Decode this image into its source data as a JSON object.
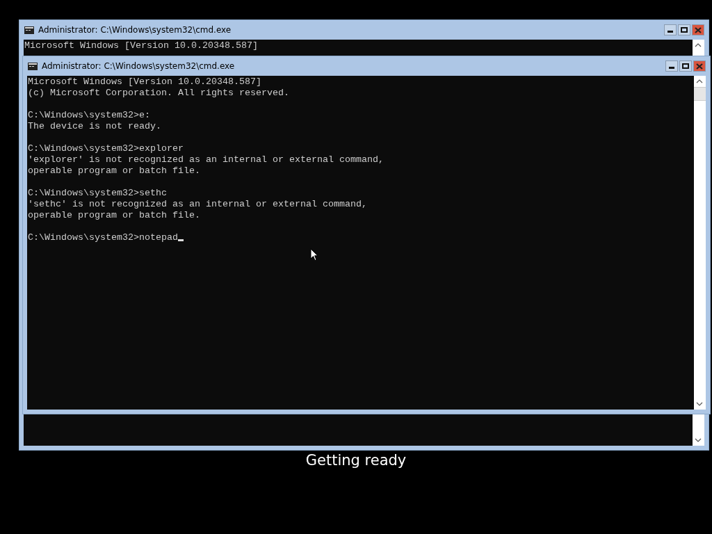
{
  "windows": [
    {
      "title": "Administrator: C:\\Windows\\system32\\cmd.exe",
      "blocks": [
        [
          "Microsoft Windows [Version 10.0.20348.587]"
        ]
      ],
      "cursor": false
    },
    {
      "title": "Administrator: C:\\Windows\\system32\\cmd.exe",
      "blocks": [
        [
          "Microsoft Windows [Version 10.0.20348.587]",
          "(c) Microsoft Corporation. All rights reserved."
        ],
        [
          "C:\\Windows\\system32>e:",
          "The device is not ready."
        ],
        [
          "C:\\Windows\\system32>explorer",
          "'explorer' is not recognized as an internal or external command,",
          "operable program or batch file."
        ],
        [
          "C:\\Windows\\system32>sethc",
          "'sethc' is not recognized as an internal or external command,",
          "operable program or batch file."
        ],
        [
          "C:\\Windows\\system32>notepad"
        ]
      ],
      "cursor": true
    }
  ],
  "status_text": "Getting ready"
}
